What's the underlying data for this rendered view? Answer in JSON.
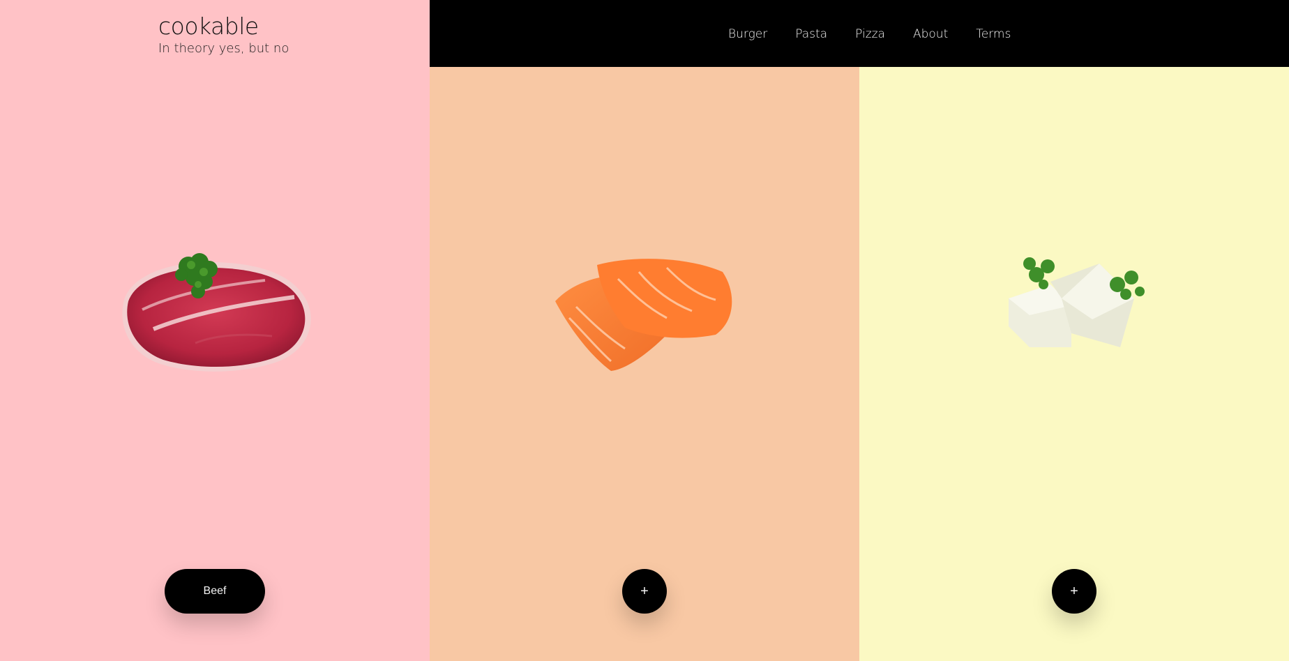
{
  "brand": {
    "title": "cookable",
    "tagline": "In theory yes, but no"
  },
  "nav": {
    "items": [
      "Burger",
      "Pasta",
      "Pizza",
      "About",
      "Terms"
    ]
  },
  "colors": {
    "beef_bg": "#ffc2c6",
    "salmon_bg": "#f8c8a4",
    "tofu_bg": "#fbf9c3",
    "topbar": "#000000"
  },
  "panels": [
    {
      "food": "beef",
      "button_label": "Beef",
      "image": "beef-steak-image"
    },
    {
      "food": "salmon",
      "button_label": "+",
      "image": "salmon-fillet-image"
    },
    {
      "food": "tofu",
      "button_label": "+",
      "image": "tofu-cubes-image"
    }
  ]
}
